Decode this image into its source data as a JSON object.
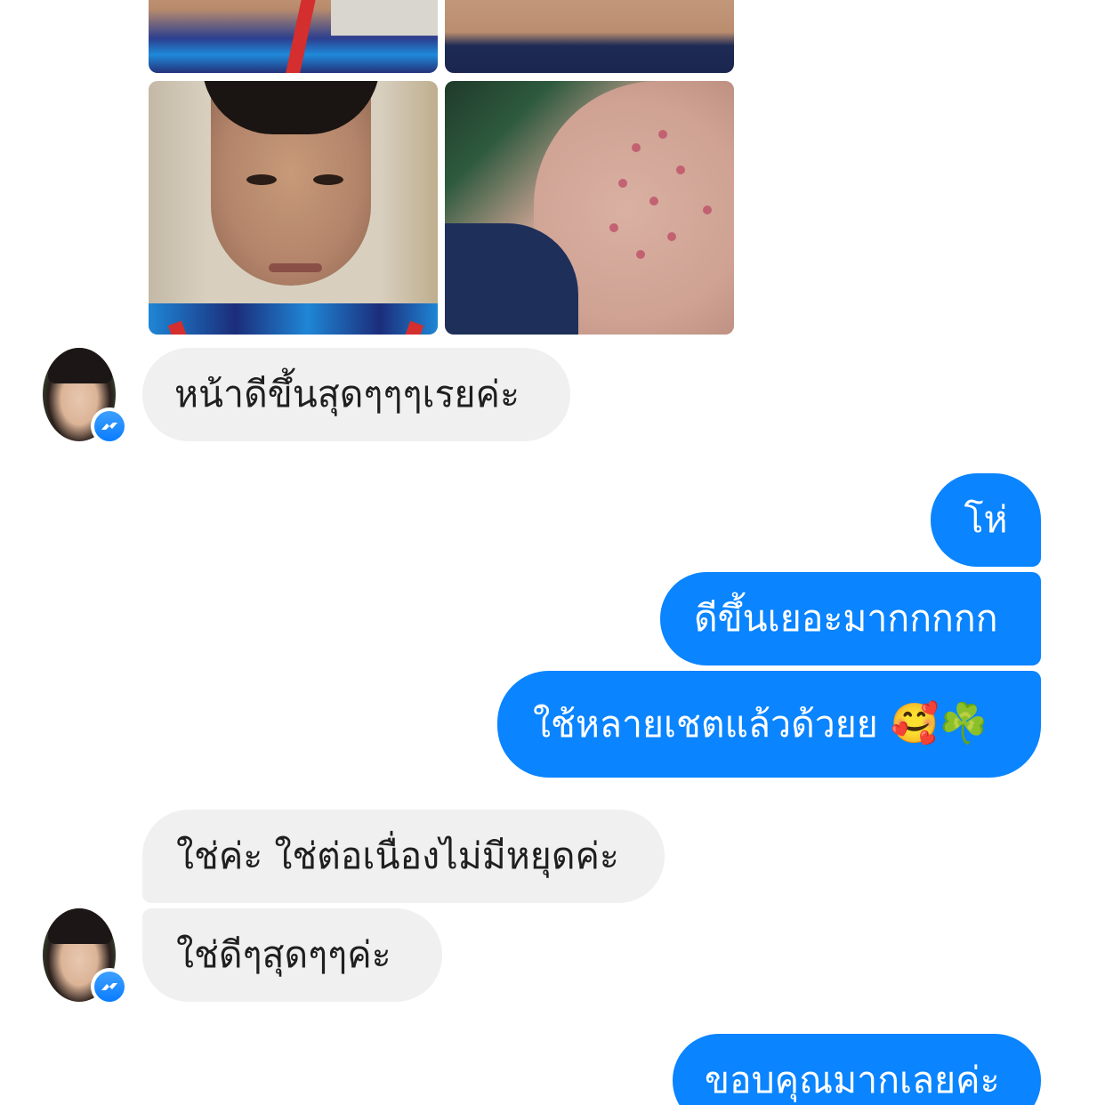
{
  "thread": {
    "shared_photos": [
      {
        "name": "photo-top-left"
      },
      {
        "name": "photo-top-right"
      },
      {
        "name": "photo-bottom-left"
      },
      {
        "name": "photo-bottom-right"
      }
    ],
    "messages": [
      {
        "sender": "contact",
        "text": "หน้าดีขึ้นสุดๆๆๆเรยค่ะ"
      },
      {
        "sender": "me",
        "text": "โห่"
      },
      {
        "sender": "me",
        "text": "ดีขึ้นเยอะมากกกกก"
      },
      {
        "sender": "me",
        "text": "ใช้หลายเชตแล้วด้วยย",
        "emoji": "🥰☘️"
      },
      {
        "sender": "contact",
        "text": "ใช่ค่ะ ใช่ต่อเนื่องไม่มีหยุดค่ะ"
      },
      {
        "sender": "contact",
        "text": "ใช่ดีๆสุดๆๆค่ะ"
      },
      {
        "sender": "me",
        "text": "ขอบคุณมากเลยค่ะ"
      }
    ]
  },
  "colors": {
    "outgoing_bubble": "#0a84ff",
    "incoming_bubble": "#f1f0f0",
    "messenger_badge": "#0a7cff"
  },
  "icons": {
    "badge": "messenger-icon"
  }
}
